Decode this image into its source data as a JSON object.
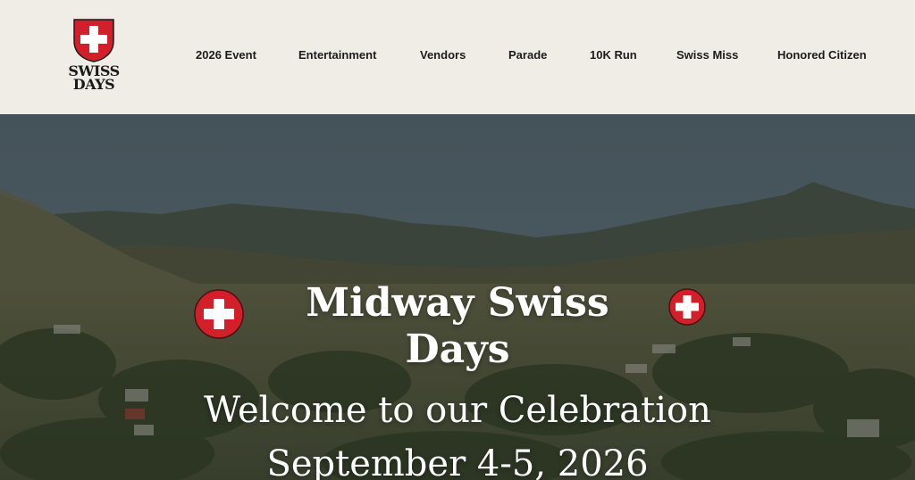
{
  "header": {
    "logo": {
      "line1": "SWISS",
      "line2": "DAYS",
      "icon": "swiss-cross-shield-icon"
    },
    "nav": [
      {
        "label": "2026 Event"
      },
      {
        "label": "Entertainment"
      },
      {
        "label": "Vendors"
      },
      {
        "label": "Parade"
      },
      {
        "label": "10K Run"
      },
      {
        "label": "Swiss Miss"
      },
      {
        "label": "Honored Citizen"
      }
    ]
  },
  "hero": {
    "title": "Midway Swiss Days",
    "subtitle": "Welcome to our Celebration",
    "date": "September 4-5, 2026",
    "left_icon": "swiss-cross-icon",
    "right_icon": "swiss-cross-icon"
  },
  "colors": {
    "header_bg": "#f0ede6",
    "nav_text": "#1c1c1c",
    "swiss_red": "#d31f2a",
    "hero_text": "#ffffff",
    "sky": "#4f5f66"
  }
}
